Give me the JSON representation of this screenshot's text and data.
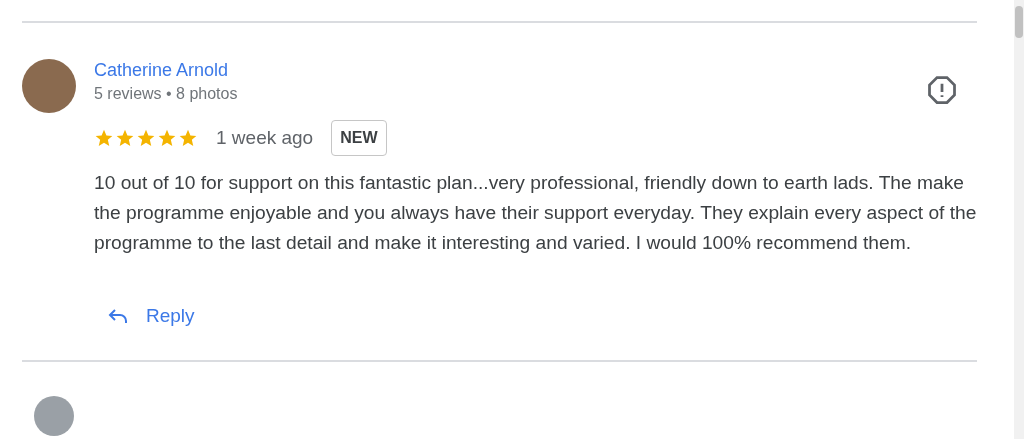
{
  "review": {
    "author": "Catherine Arnold",
    "meta": "5 reviews • 8 photos",
    "stars": 5,
    "time": "1 week ago",
    "badge": "NEW",
    "text": "10 out of 10 for support on this fantastic plan...very professional, friendly down to earth lads. The make the programme enjoyable and you always have their support everyday. They explain every aspect of the programme to the last detail and make it interesting and varied. I would 100% recommend them.",
    "reply_label": "Reply"
  }
}
